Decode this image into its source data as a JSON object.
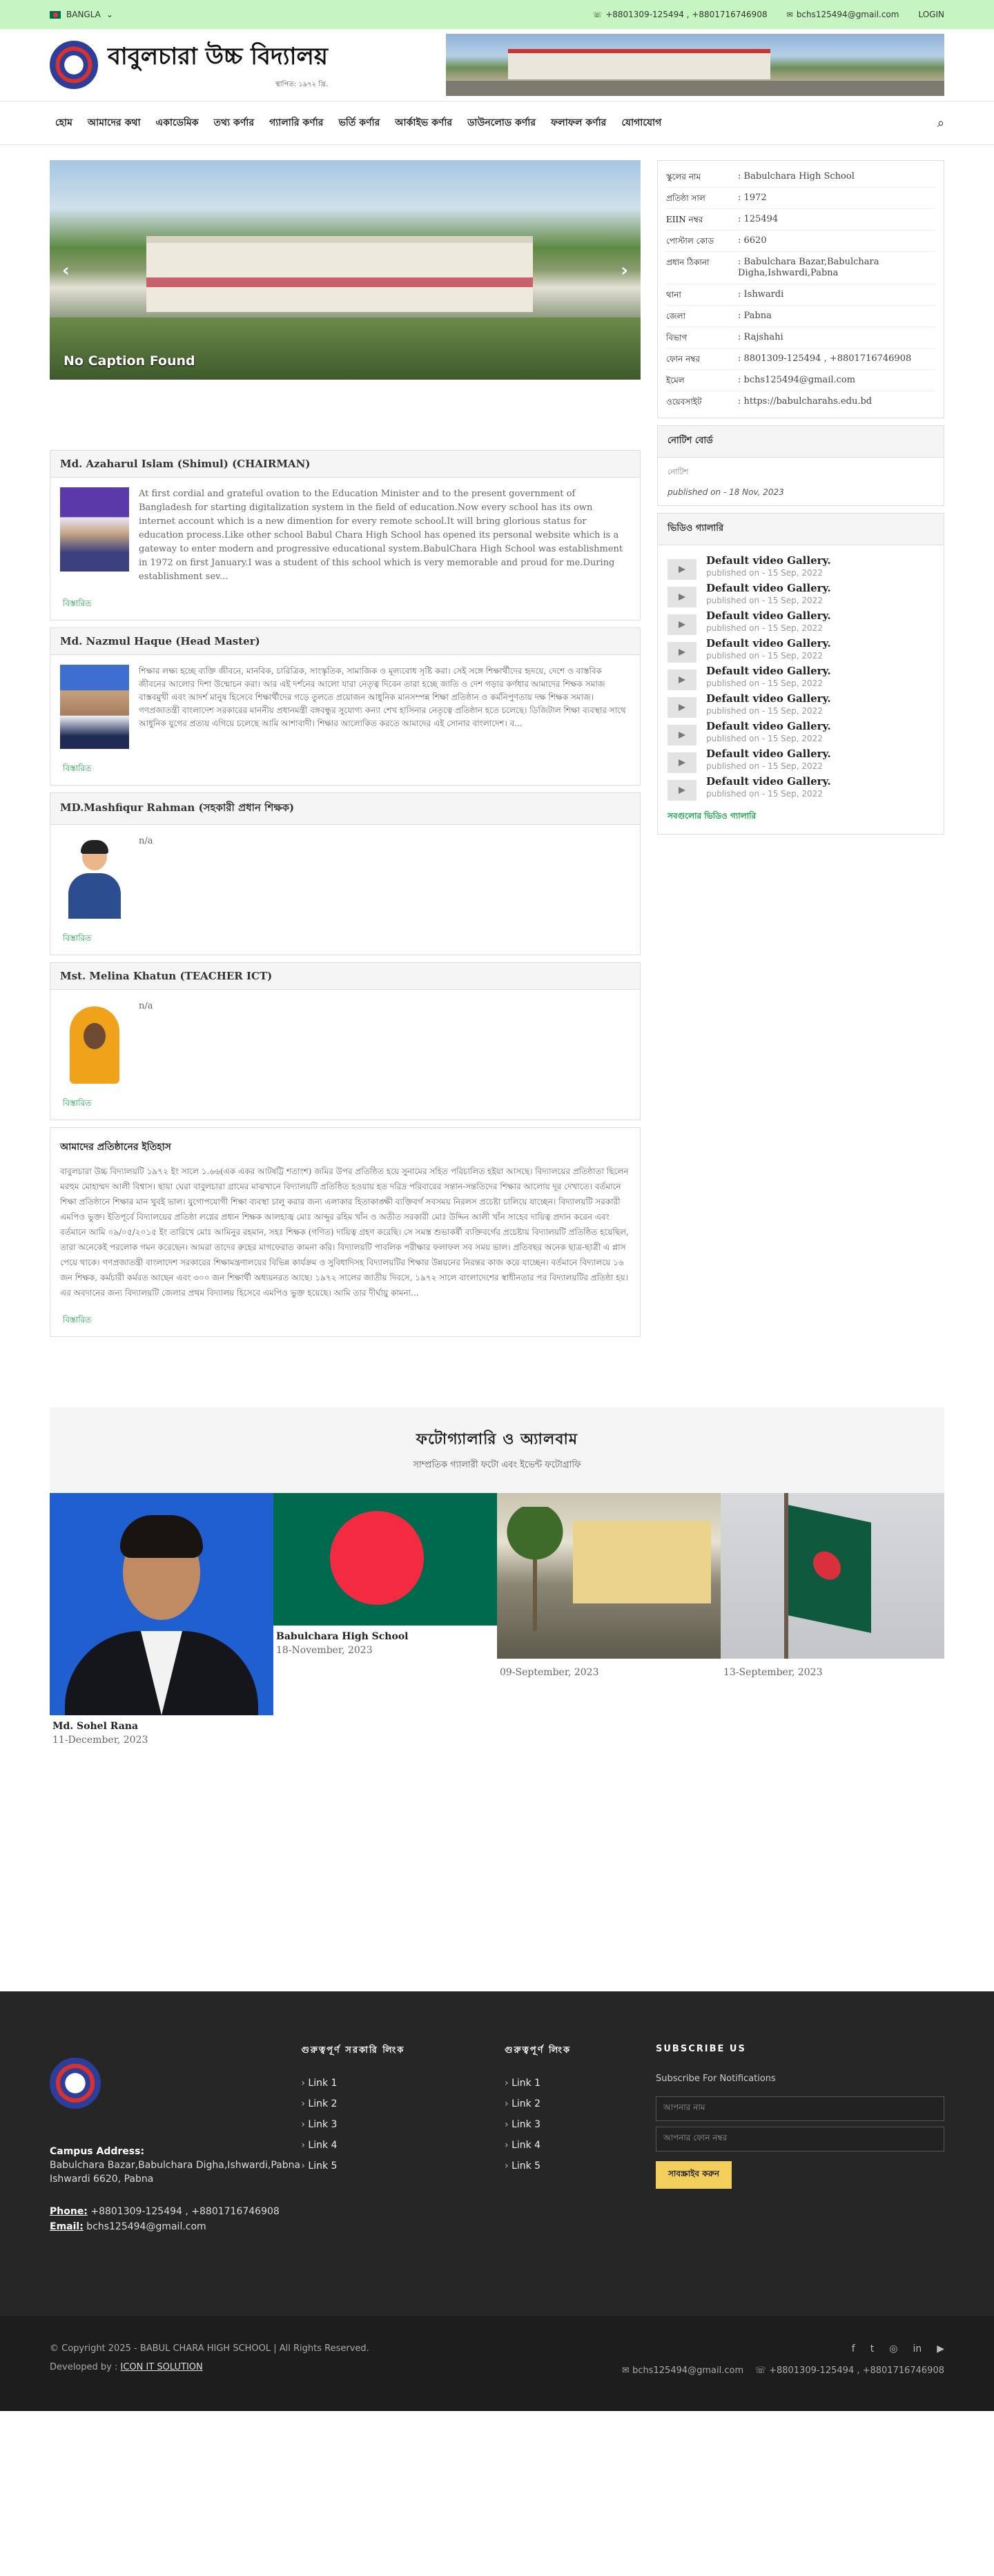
{
  "topbar": {
    "language": "BANGLA",
    "phone": "+8801309-125494 , +8801716746908",
    "email": "bchs125494@gmail.com",
    "login": "LOGIN"
  },
  "header": {
    "school_name": "বাবুলচারা উচ্চ বিদ্যালয়",
    "established": "স্থাপিত: ১৯৭২ খ্রি."
  },
  "nav": {
    "items": [
      "হোম",
      "আমাদের কথা",
      "একাডেমিক",
      "তথ্য কর্ণার",
      "গ্যালারি কর্ণার",
      "ভর্তি কর্ণার",
      "আর্কাইভ কর্ণার",
      "ডাউনলোড কর্ণার",
      "ফলাফল কর্ণার",
      "যোগাযোগ"
    ]
  },
  "slider": {
    "caption": "No Caption Found"
  },
  "messages": [
    {
      "title": "Md. Azaharul Islam (Shimul) (CHAIRMAN)",
      "text": "At first cordial and grateful ovation to the Education Minister and to the present government of Bangladesh for starting digitalization system in the field of education.Now every school has its own internet account which is a new dimention for every remote school.It will bring glorious status for education process.Like other school Babul Chara High School has opened its personal website which is a gateway to enter modern and progressive educational system.BabulChara High School was establishment in 1972 on first January.I was a student of this school which is very memorable and proud for me.During establishment sev...",
      "more": "বিস্তারিত"
    },
    {
      "title": "Md. Nazmul Haque (Head Master)",
      "text": "শিক্ষার লক্ষ্য হচ্ছে ব্যক্তি জীবনে, মানবিক, চারিত্রিক, সাংস্কৃতিক, সামাজিক ও মূল্যবোধ সৃষ্টি করা। সেই সঙ্গে শিক্ষার্থীদের হৃদয়ে, দেশে ও বাস্তবিক জীবনের আলোর দিশা উন্মোচন করা। আর এই দর্শনের আলো যারা নেতৃত্ব দিবেন তারা হচ্ছে জাতি ও দেশ গড়ার কর্ণধার আমাদের শিক্ষক সমাজ বাস্তবমুখী এবং আদর্শ মানুষ হিসেবে শিক্ষার্থীদের গড়ে তুলতে প্রয়োজন আধুনিক মানসম্পন্ন শিক্ষা প্রতিষ্ঠান ও কর্মনিপুণতায় দক্ষ শিক্ষক সমাজ। গণপ্রজাতন্ত্রী বাংলাদেশ সরকারের মাননীয় প্রধানমন্ত্রী বঙ্গবন্ধুর সুযোগ্য কন্যা শেখ হাসিনার নেতৃত্বে প্রতিষ্ঠান হতে চলেছে। ডিজিটাল শিক্ষা ব্যবস্থার সাথে আধুনিক যুগের প্রত্যয় এগিয়ে চলেছে আমি আশাবাদী। শিক্ষার আলোকিত করতে আমাদের এই সোনার বাংলাদেশ। ব...",
      "more": "বিস্তারিত"
    },
    {
      "title": "MD.Mashfiqur Rahman (সহকারী প্রধান শিক্ষক)",
      "text": "n/a",
      "more": "বিস্তারিত"
    },
    {
      "title": "Mst. Melina Khatun (TEACHER ICT)",
      "text": "n/a",
      "more": "বিস্তারিত"
    }
  ],
  "history": {
    "title": "আমাদের প্রতিষ্ঠানের ইতিহাস",
    "text": "বাবুলচারা উচ্চ বিদ্যালয়টি ১৯৭২ ইং সালে ১.৬৬(এক একর আটষট্টি শতাংশ) জমির উপর প্রতিষ্ঠিত হয়ে সুনামের সহিত পরিচালিত হইয়া আসছে। বিদ্যালয়ের প্রতিষ্ঠাতা ছিলেন মরহুম মোহাম্মদ আলী বিশ্বাস। ছায়া ঘেরা বাবুলচারা গ্রামের মাঝখানে বিদ্যালয়টি প্রতিষ্ঠিত হওয়ায় হত দরিদ্র পরিবারের সন্তান-সন্ততিদের শিক্ষার আলোয় দূর দেখাতে। বর্তমানে শিক্ষা প্রতিষ্ঠানে শিক্ষার মান খুবই ভাল। যুগোপযোগী শিক্ষা ব্যবস্থা চালু করার জন্য এলাকার হিতাকাঙ্ক্ষী ব্যক্তিবর্গ সবসময় নিরলস প্রচেষ্টা চালিয়ে যাচ্ছেন। বিদ্যালয়টি সরকারী এমপিও ভুক্ত। ইতিপূর্বে বিদ্যালয়ের প্রতিষ্ঠা লগ্নের প্রধান শিক্ষক আলহাজ্ব মোঃ আব্দুর রহিম খাঁন ও অতীত সরকারী মোঃ উদ্দিন আলী খাঁন সাহেব দায়িত্ব প্রদান করেন এবং বর্তমানে আমি ০৯/০৫/২০১৫ ইং তারিখে মোঃ আমিনুর রহমান, সহঃ শিক্ষক (গণিত) দায়িত্ব গ্রহণ করেছি। সে সমস্ত শুভাকর্ষী ব্যক্তিবর্গের প্রচেষ্টায় বিদ্যালয়টি প্রতিষ্ঠিত হয়েছিল, তারা অনেকেই পরলোক গমন করেছেন। আমরা তাদের রুহের মাগফেরাত কামনা করি। বিদ্যালয়টি পাবলিক পরীক্ষার ফলাফল সব সময় ভাল। প্রতিবছর অনেক ছাত্র-ছাত্রী এ প্লাস পেয়ে থাকে। গণপ্রজাতন্ত্রী বাংলাদেশ সরকারের শিক্ষামন্ত্রণালয়ের বিভিন্ন কার্যক্রম ও সুবিধাদিসহ বিদ্যালয়টির শিক্ষার উন্নয়নের নিরন্তর কাজ করে যাচ্ছেন। বর্তমানে বিদ্যালয়ে ১৬ জন শিক্ষক, কর্মচারী কর্মরত আছেন এবং ৩০০ জন শিক্ষার্থী অধ্যয়নরত আছে। ১৯৭২ সালের জাতীয় দিবসে, ১৯৭২ সালে বাংলাদেশের স্বাধীনতার পর বিদ্যালয়টির প্রতিষ্ঠা হয়। এর অবদানের জন্য বিদ্যালয়টি জেলার প্রথম বিদ্যালয় হিসেবে এমপিও ভুক্ত হয়েছে। আমি তার দীর্ঘায়ু কামনা...",
    "more": "বিস্তারিত"
  },
  "info": [
    {
      "k": "স্কুলের নাম",
      "v": "Babulchara High School"
    },
    {
      "k": "প্রতিষ্ঠা সাল",
      "v": "1972"
    },
    {
      "k": "EIIN নম্বর",
      "v": "125494"
    },
    {
      "k": "পোস্টাল কোড",
      "v": "6620"
    },
    {
      "k": "প্রধান ঠিকানা",
      "v": "Babulchara Bazar,Babulchara Digha,Ishwardi,Pabna"
    },
    {
      "k": "থানা",
      "v": "Ishwardi"
    },
    {
      "k": "জেলা",
      "v": "Pabna"
    },
    {
      "k": "বিভাগ",
      "v": "Rajshahi"
    },
    {
      "k": "ফোন নম্বর",
      "v": "8801309-125494 , +8801716746908"
    },
    {
      "k": "ইমেল",
      "v": "bchs125494@gmail.com"
    },
    {
      "k": "ওয়েবসাইট",
      "v": "https://babulcharahs.edu.bd"
    }
  ],
  "notice": {
    "head": "নোটিশ বোর্ড",
    "title": "নোটিশ",
    "published": "published on - 18 Nov, 2023"
  },
  "videos": {
    "head": "ভিডিও গ্যালারি",
    "items": [
      {
        "title": "Default video Gallery.",
        "date": "published on - 15 Sep, 2022"
      },
      {
        "title": "Default video Gallery.",
        "date": "published on - 15 Sep, 2022"
      },
      {
        "title": "Default video Gallery.",
        "date": "published on - 15 Sep, 2022"
      },
      {
        "title": "Default video Gallery.",
        "date": "published on - 15 Sep, 2022"
      },
      {
        "title": "Default video Gallery.",
        "date": "published on - 15 Sep, 2022"
      },
      {
        "title": "Default video Gallery.",
        "date": "published on - 15 Sep, 2022"
      },
      {
        "title": "Default video Gallery.",
        "date": "published on - 15 Sep, 2022"
      },
      {
        "title": "Default video Gallery.",
        "date": "published on - 15 Sep, 2022"
      },
      {
        "title": "Default video Gallery.",
        "date": "published on - 15 Sep, 2022"
      }
    ],
    "all": "সবগুলোর ভিডিও গ্যালারি"
  },
  "gallery": {
    "title": "ফটোগ্যালারি ও অ্যালবাম",
    "subtitle": "সাম্প্রতিক গ্যালারী ফটো এবং ইভেন্ট ফটোগ্রাফি",
    "items": [
      {
        "name": "Md. Sohel Rana",
        "date": "11-December, 2023"
      },
      {
        "name": "Babulchara High School",
        "date": "18-November, 2023"
      },
      {
        "name": "",
        "date": "09-September, 2023"
      },
      {
        "name": "",
        "date": "13-September, 2023"
      }
    ]
  },
  "footer": {
    "address_label": "Campus Address:",
    "address": "Babulchara Bazar,Babulchara Digha,Ishwardi,Pabna Ishwardi 6620, Pabna",
    "phone_label": "Phone:",
    "phone": "+8801309-125494 , +8801716746908",
    "email_label": "Email:",
    "email": "bchs125494@gmail.com",
    "col2_head": "গুরুত্বপূর্ণ সরকারি লিংক",
    "col3_head": "গুরুত্বপূর্ণ লিংক",
    "links2": [
      "Link 1",
      "Link 2",
      "Link 3",
      "Link 4",
      "Link 5"
    ],
    "links3": [
      "Link 1",
      "Link 2",
      "Link 3",
      "Link 4",
      "Link 5"
    ],
    "subscribe_head": "SUBSCRIBE US",
    "subscribe_text": "Subscribe For Notifications",
    "name_placeholder": "আপনার নাম",
    "phone_placeholder": "আপনার ফোন নম্বর",
    "submit": "সাবস্ক্রাইব করুন",
    "copyright": "© Copyright 2025 - BABUL CHARA HIGH SCHOOL | All Rights Reserved.",
    "developed_by": "Developed by :",
    "developer": "ICON IT SOLUTION",
    "bottom_email": "bchs125494@gmail.com",
    "bottom_phone": "+8801309-125494 , +8801716746908"
  }
}
